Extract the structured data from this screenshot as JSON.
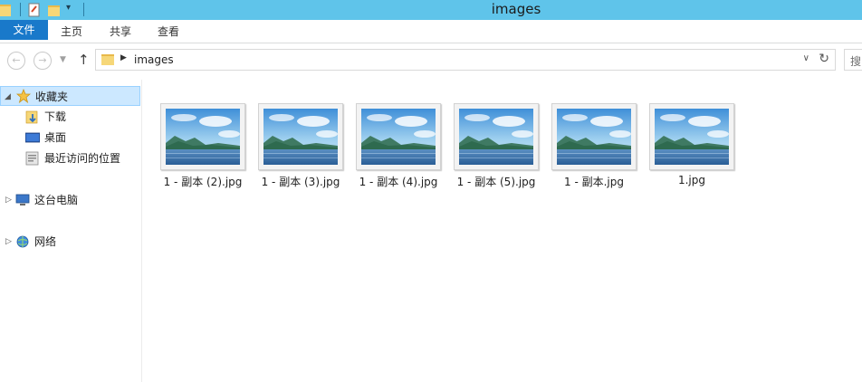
{
  "window": {
    "title": "images"
  },
  "ribbon": {
    "tabs": [
      "文件",
      "主页",
      "共享",
      "查看"
    ]
  },
  "navbar": {
    "address": "images",
    "search_placeholder": "搜"
  },
  "sidebar": {
    "items": [
      {
        "label": "收藏夹",
        "icon": "star-icon"
      },
      {
        "label": "下载",
        "icon": "download-folder-icon"
      },
      {
        "label": "桌面",
        "icon": "desktop-icon"
      },
      {
        "label": "最近访问的位置",
        "icon": "recent-places-icon"
      },
      {
        "label": "这台电脑",
        "icon": "computer-icon"
      },
      {
        "label": "网络",
        "icon": "network-icon"
      }
    ]
  },
  "files": [
    {
      "name": "1 - 副本 (2).jpg"
    },
    {
      "name": "1 - 副本 (3).jpg"
    },
    {
      "name": "1 - 副本 (4).jpg"
    },
    {
      "name": "1 - 副本 (5).jpg"
    },
    {
      "name": "1 - 副本.jpg"
    },
    {
      "name": "1.jpg"
    }
  ],
  "colors": {
    "titlebar": "#5fc4ea",
    "file_tab": "#1979ca",
    "selection": "#cce8ff"
  }
}
